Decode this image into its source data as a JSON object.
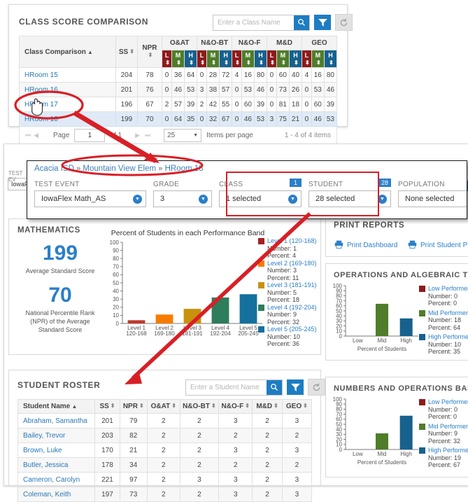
{
  "class_panel": {
    "title": "CLASS SCORE COMPARISON",
    "search": {
      "placeholder": "Enter a Class Name",
      "value": ""
    },
    "icons": {
      "search": "search-icon",
      "filter": "filter-icon",
      "refresh": "refresh-icon"
    },
    "columns": {
      "name": "Class Comparison",
      "ss": "SS",
      "npr": "NPR",
      "groups": [
        "O&AT",
        "N&O-BT",
        "N&O-F",
        "M&D",
        "GEO"
      ],
      "sub": [
        "L",
        "M",
        "H"
      ]
    },
    "rows": [
      {
        "name": "HRoom 15",
        "ss": "204",
        "npr": "78",
        "cells": [
          "0",
          "36",
          "64",
          "0",
          "28",
          "72",
          "4",
          "16",
          "80",
          "0",
          "60",
          "40",
          "4",
          "16",
          "80"
        ]
      },
      {
        "name": "HRoom 16",
        "ss": "201",
        "npr": "76",
        "cells": [
          "0",
          "46",
          "53",
          "3",
          "38",
          "57",
          "0",
          "53",
          "46",
          "0",
          "73",
          "26",
          "0",
          "53",
          "46"
        ]
      },
      {
        "name": "HRoom 17",
        "ss": "196",
        "npr": "67",
        "cells": [
          "2",
          "57",
          "39",
          "2",
          "42",
          "55",
          "0",
          "60",
          "39",
          "0",
          "81",
          "18",
          "0",
          "60",
          "39"
        ]
      },
      {
        "name": "HRoom 18",
        "ss": "199",
        "npr": "70",
        "cells": [
          "0",
          "64",
          "35",
          "0",
          "32",
          "67",
          "0",
          "46",
          "53",
          "3",
          "75",
          "21",
          "0",
          "46",
          "53"
        ]
      }
    ],
    "pager": {
      "page_label": "Page",
      "page_value": "1",
      "of_label": "of 1",
      "per_page": "25",
      "per_page_label": "Items per page",
      "range": "1 - 4 of 4 items"
    }
  },
  "mid_window": {
    "breadcrumb": {
      "district": "Acacia ISD",
      "school": "Mountain View Elem",
      "current": "HRoom 18",
      "separator": "»"
    },
    "filters": [
      {
        "label": "TEST EVENT",
        "value": "IowaFlex Math_AS",
        "badge": ""
      },
      {
        "label": "GRADE",
        "value": "3",
        "badge": ""
      },
      {
        "label": "CLASS",
        "value": "1 selected",
        "badge": "1"
      },
      {
        "label": "STUDENT",
        "value": "28 selected",
        "badge": "28"
      },
      {
        "label": "POPULATION",
        "value": "None selected",
        "badge": ""
      }
    ],
    "ghost_left": {
      "label": "TEST EV",
      "value": "IowaF"
    },
    "ghost_right": {
      "label": "st P"
    }
  },
  "math_panel": {
    "title": "MATHEMATICS",
    "avg_score": "199",
    "avg_score_caption": "Average Standard Score",
    "npr": "70",
    "npr_caption": "National Percentile Rank (NPR) of the Average Standard Score"
  },
  "print_panel": {
    "title": "PRINT REPORTS",
    "links": [
      {
        "label": "Print Dashboard",
        "icon": "printer-icon"
      },
      {
        "label": "Print Student Profile",
        "icon": "printer-icon"
      }
    ]
  },
  "roster_panel": {
    "title": "STUDENT ROSTER",
    "search": {
      "placeholder": "Enter a Student Name",
      "value": ""
    },
    "columns": [
      "Student Name",
      "SS",
      "NPR",
      "O&AT",
      "N&O-BT",
      "N&O-F",
      "M&D",
      "GEO"
    ],
    "rows": [
      {
        "name": "Abraham, Samantha",
        "v": [
          "201",
          "79",
          "2",
          "2",
          "3",
          "2",
          "3"
        ]
      },
      {
        "name": "Bailey, Trevor",
        "v": [
          "203",
          "82",
          "2",
          "2",
          "2",
          "2",
          "2"
        ]
      },
      {
        "name": "Brown, Luke",
        "v": [
          "170",
          "21",
          "2",
          "2",
          "3",
          "2",
          "3"
        ]
      },
      {
        "name": "Butler, Jessica",
        "v": [
          "178",
          "34",
          "2",
          "2",
          "2",
          "2",
          "2"
        ]
      },
      {
        "name": "Cameron, Carolyn",
        "v": [
          "221",
          "97",
          "2",
          "3",
          "3",
          "2",
          "3"
        ]
      },
      {
        "name": "Coleman, Keith",
        "v": [
          "197",
          "73",
          "2",
          "2",
          "3",
          "2",
          "3"
        ]
      }
    ]
  },
  "chart_data": [
    {
      "type": "bar",
      "name": "performance-band-chart",
      "title": "Percent of Students in each Performance Band",
      "xlabel": "",
      "ylabel": "",
      "ylim": [
        0,
        100
      ],
      "yticks": [
        0,
        10,
        20,
        30,
        40,
        50,
        60,
        70,
        80,
        90,
        100
      ],
      "categories": [
        "Level 1\n120-168",
        "Level 2\n169-180",
        "Level 3\n181-191",
        "Level 4\n192-204",
        "Level 5\n205-245"
      ],
      "values": [
        4,
        11,
        18,
        32,
        36
      ],
      "colors": [
        "#c0392b",
        "#f57c00",
        "#c9920c",
        "#2e7d5b",
        "#14719e"
      ],
      "legend_position": "right",
      "legend": [
        {
          "title": "Level 1 (120-168)",
          "number": "Number: 1",
          "percent": "Percent: 4",
          "color": "#a62020"
        },
        {
          "title": "Level 2 (169-180)",
          "number": "Number: 3",
          "percent": "Percent: 11",
          "color": "#f57c00"
        },
        {
          "title": "Level 3 (181-191)",
          "number": "Number: 5",
          "percent": "Percent: 18",
          "color": "#c9920c"
        },
        {
          "title": "Level 4 (192-204)",
          "number": "Number: 9",
          "percent": "Percent: 32",
          "color": "#2e7d5b"
        },
        {
          "title": "Level 5 (205-245)",
          "number": "Number: 10",
          "percent": "Percent: 36",
          "color": "#14719e"
        }
      ]
    },
    {
      "type": "bar",
      "name": "oat-chart",
      "title": "OPERATIONS AND ALGEBRAIC THINKING",
      "xlabel": "Percent of Students",
      "ylim": [
        0,
        100
      ],
      "yticks": [
        0,
        10,
        20,
        30,
        40,
        50,
        60,
        70,
        80,
        90,
        100
      ],
      "categories": [
        "Low",
        "Mid",
        "High"
      ],
      "values": [
        0,
        64,
        35
      ],
      "colors": [
        "#8e1b1b",
        "#4f7d2a",
        "#17618f"
      ],
      "legend_position": "right",
      "legend": [
        {
          "title": "Low Performer",
          "number": "Number: 0",
          "percent": "Percent: 0",
          "color": "#8e1b1b"
        },
        {
          "title": "Mid Performer",
          "number": "Number: 18",
          "percent": "Percent: 64",
          "color": "#4f7d2a"
        },
        {
          "title": "High Performer",
          "number": "Number: 10",
          "percent": "Percent: 35",
          "color": "#17618f"
        }
      ]
    },
    {
      "type": "bar",
      "name": "nobt-chart",
      "title": "NUMBERS AND OPERATIONS BASE TEN",
      "xlabel": "Percent of Students",
      "ylim": [
        0,
        100
      ],
      "yticks": [
        0,
        10,
        20,
        30,
        40,
        50,
        60,
        70,
        80,
        90,
        100
      ],
      "categories": [
        "Low",
        "Mid",
        "High"
      ],
      "values": [
        0,
        32,
        67
      ],
      "colors": [
        "#8e1b1b",
        "#4f7d2a",
        "#17618f"
      ],
      "legend_position": "right",
      "legend": [
        {
          "title": "Low Performer",
          "number": "Number: 0",
          "percent": "Percent: 0",
          "color": "#8e1b1b"
        },
        {
          "title": "Mid Performer",
          "number": "Number: 9",
          "percent": "Percent: 32",
          "color": "#4f7d2a"
        },
        {
          "title": "High Performer",
          "number": "Number: 19",
          "percent": "Percent: 67",
          "color": "#17618f"
        }
      ]
    }
  ],
  "annotations": {
    "color": "#d81f26",
    "cursor_icon": "hand-cursor-icon"
  }
}
